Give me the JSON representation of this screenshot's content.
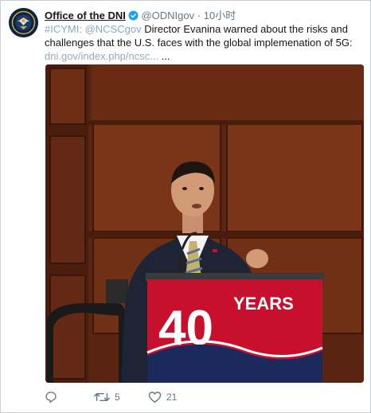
{
  "tweet": {
    "display_name": "Office of the DNI",
    "handle": "@ODNIgov",
    "separator": "·",
    "time": "10小时",
    "hashtag": "#ICYMI:",
    "mention": "@NCSCgov",
    "body": " Director Evanina warned about the risks and challenges that the U.S. faces with the global implemenation of 5G: ",
    "link": "dni.gov/index.php/ncsc...",
    "ellipsis": " ...",
    "ellipsis2": "..."
  },
  "media": {
    "podium_number": "40",
    "podium_word": "YEARS"
  },
  "actions": {
    "reply_count": "",
    "retweet_count": "5",
    "like_count": "21"
  },
  "colors": {
    "link_blue": "#8aa8c3",
    "verified_blue": "#1da1f2",
    "podium_red": "#c8102e",
    "podium_navy": "#1b2a5c",
    "wood": "#6b2c14"
  },
  "icons": [
    "seal-avatar",
    "verified-icon",
    "reply-icon",
    "retweet-icon",
    "like-icon"
  ]
}
